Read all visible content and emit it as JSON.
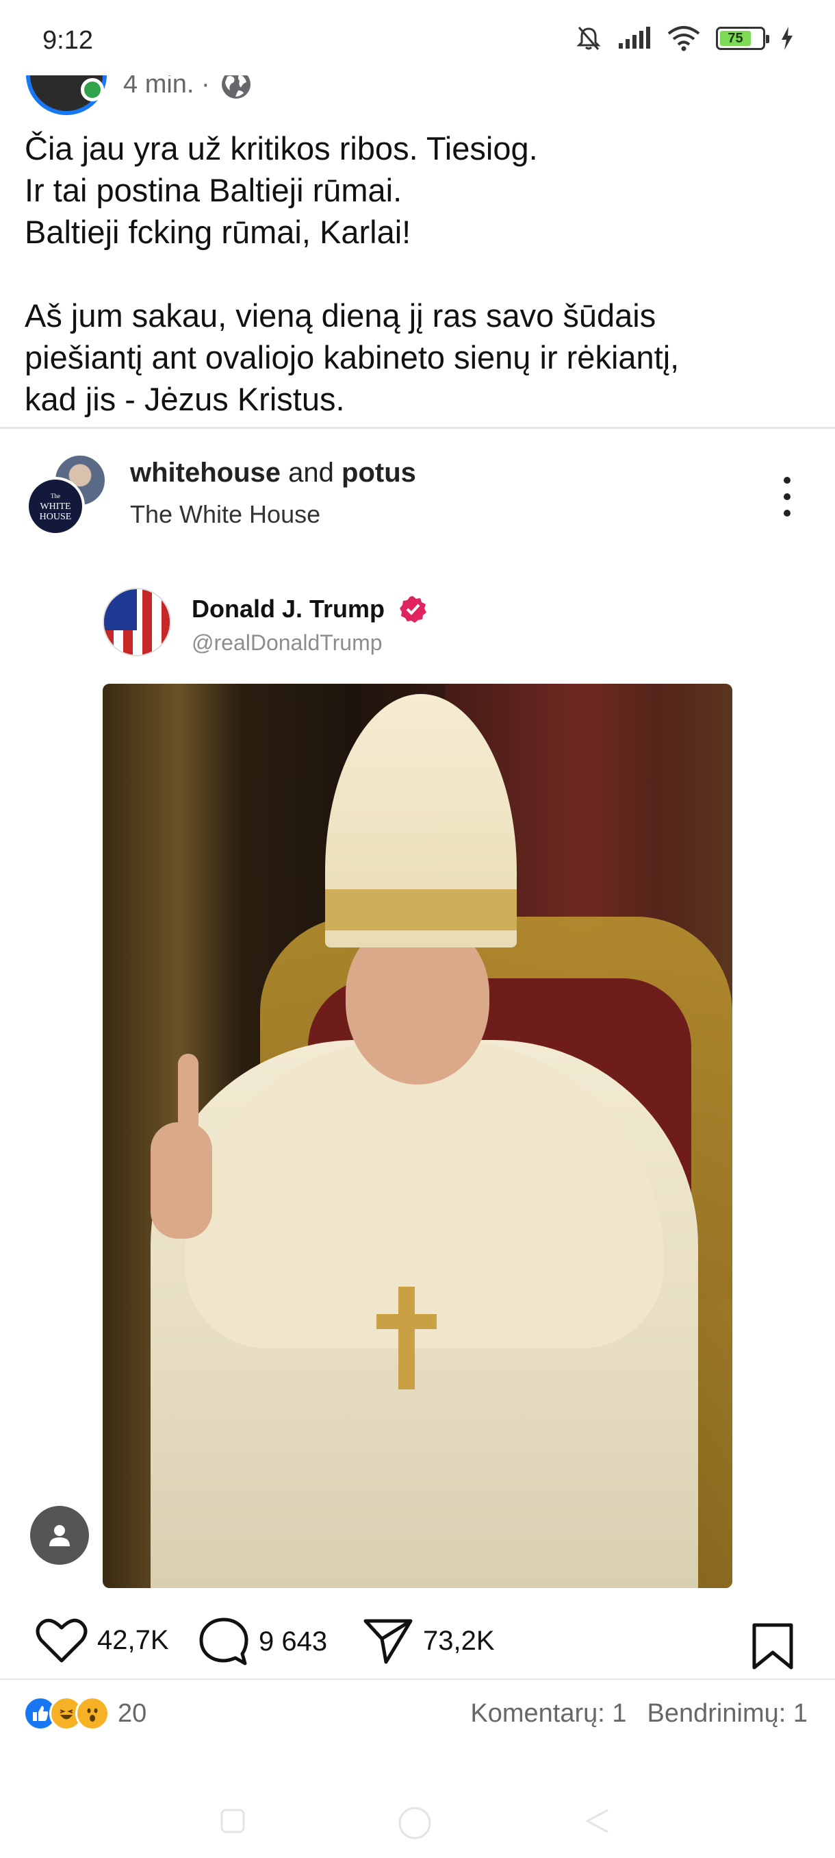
{
  "status_bar": {
    "time": "9:12",
    "battery_level": "75",
    "icons": [
      "bell-off-icon",
      "signal-icon",
      "wifi-icon",
      "battery-icon",
      "charging-icon"
    ]
  },
  "post": {
    "time": "4 min. ·",
    "visibility_icon": "globe-icon",
    "text": "Čia jau yra už kritikos ribos. Tiesiog.\nIr tai postina Baltieji rūmai.\nBaltieji fcking rūmai, Karlai!\n\nAš jum sakau, vieną dieną jį ras savo šūdais\npiešiantį ant ovaliojo kabineto sienų ir rėkiantį,\nkad jis - Jėzus Kristus."
  },
  "shared": {
    "account_1": "whitehouse",
    "joiner": "and",
    "account_2": "potus",
    "subtitle": "The White House",
    "logo_text": [
      "The",
      "WHITE",
      "HOUSE"
    ]
  },
  "tweet": {
    "name": "Donald J. Trump",
    "handle": "@realDonaldTrump"
  },
  "actions": {
    "likes": "42,7K",
    "comments": "9 643",
    "shares": "73,2K"
  },
  "footer": {
    "reaction_count": "20",
    "comments_label": "Komentarų: 1",
    "shares_label": "Bendrinimų: 1"
  },
  "colors": {
    "facebook_blue": "#1877f2",
    "online_green": "#31a24c",
    "secondary_text": "#65676b",
    "verified_pink": "#e0245e",
    "battery_green": "#7ed957"
  }
}
